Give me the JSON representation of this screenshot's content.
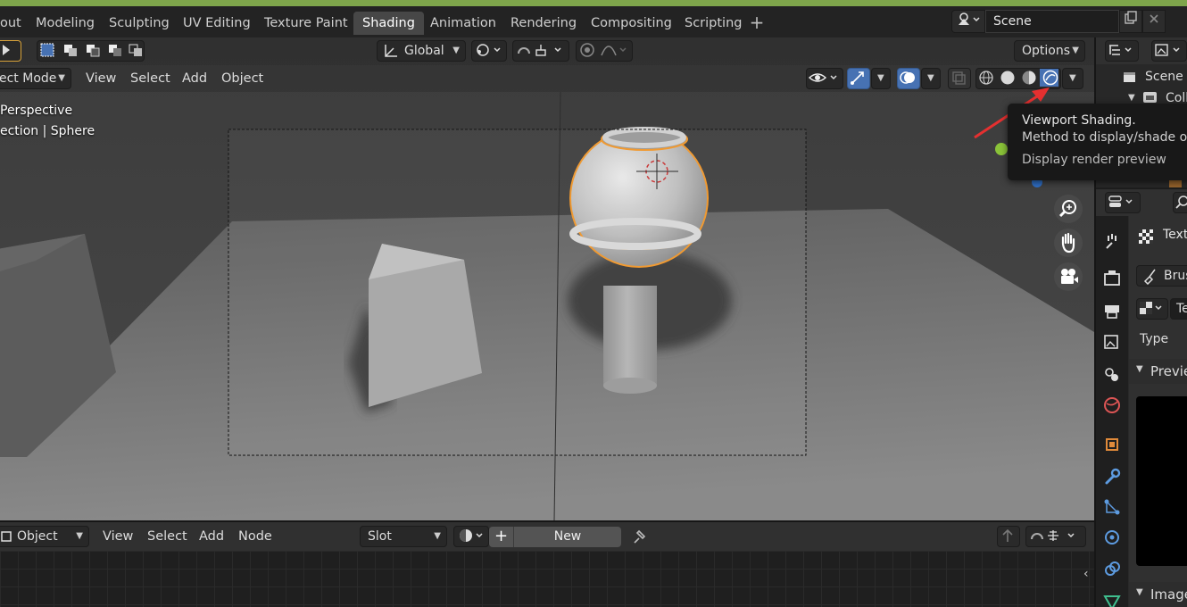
{
  "workspace_tabs": [
    {
      "label": "out",
      "active": false
    },
    {
      "label": "Modeling",
      "active": false
    },
    {
      "label": "Sculpting",
      "active": false
    },
    {
      "label": "UV Editing",
      "active": false
    },
    {
      "label": "Texture Paint",
      "active": false
    },
    {
      "label": "Shading",
      "active": true
    },
    {
      "label": "Animation",
      "active": false
    },
    {
      "label": "Rendering",
      "active": false
    },
    {
      "label": "Compositing",
      "active": false
    },
    {
      "label": "Scripting",
      "active": false
    }
  ],
  "add_workspace": "+",
  "scene": {
    "name": "Scene"
  },
  "viewport": {
    "transform_orientation": "Global",
    "options_label": "Options",
    "mode": "ect Mode",
    "menus": [
      "View",
      "Select",
      "Add",
      "Object"
    ],
    "overlay_line1": "Perspective",
    "overlay_line2": "ection | Sphere"
  },
  "tooltip": {
    "title": "Viewport Shading.",
    "description": "Method to display/shade obje",
    "detail": "Display render preview"
  },
  "outliner": {
    "scene_collection": "Scene C",
    "collection": "Coll"
  },
  "properties": {
    "texture_label": "Text",
    "brush_label": "Brus",
    "texture_dropdown": "Te",
    "type_label": "Type",
    "preview_label": "Previe",
    "image_label": "Image"
  },
  "node_editor": {
    "mode": "Object",
    "menus": [
      "View",
      "Select",
      "Add",
      "Node"
    ],
    "slot_label": "Slot",
    "new_plus": "+",
    "new_label": "New"
  },
  "colors": {
    "accent_blue": "#4772b3",
    "selection_orange": "#f0962a",
    "tooltip_arrow": "#e53030",
    "title_green": "#7ea54b"
  }
}
